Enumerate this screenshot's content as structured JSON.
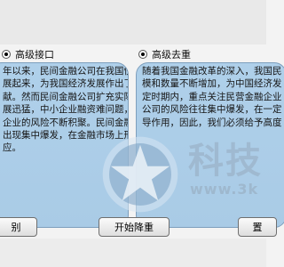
{
  "left_panel": {
    "radio_label": "高级接口",
    "lines": [
      "年以来，民间金融公司在我国快速发",
      "展起来，为我国经济发展作出了巨大贡",
      "献。然而民间金融公司扩充实际上也",
      "展迅猛，中小企业融资难问题，使民间金融",
      "企业的风险不断积聚。民间金融公司的风险往往",
      "出现集中爆发，在金融市场上形成危机，并且具有传导效应",
      "应。"
    ],
    "button_label": "别"
  },
  "right_panel": {
    "radio_label": "高级去重",
    "lines": [
      "随着我国金融改革的深入，我国民",
      "模和数量不断增加，为中国经济发",
      "定时期内，重点关注民营金融企业",
      "公司的风险往往集中爆发，在一定",
      "导作用，因此，我们必须给予高度"
    ],
    "button_label": "置"
  },
  "center_button_label": "开始降重",
  "watermark": {
    "text": "科技",
    "url": "www.3k"
  }
}
